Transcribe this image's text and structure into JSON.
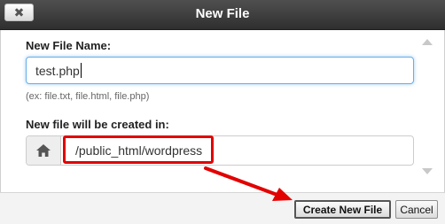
{
  "dialog": {
    "title": "New File",
    "close_glyph": "✖",
    "file_name_label": "New File Name:",
    "file_name_value": "test.php",
    "hint": "(ex: file.txt, file.html, file.php)",
    "directory_label": "New file will be created in:",
    "directory_value": "/public_html/wordpress",
    "home_icon": "home-icon",
    "create_label": "Create New File",
    "cancel_label": "Cancel"
  },
  "colors": {
    "titlebar": "#3a3a3a",
    "annotation": "#e20000",
    "focus_border": "#66afe9"
  }
}
